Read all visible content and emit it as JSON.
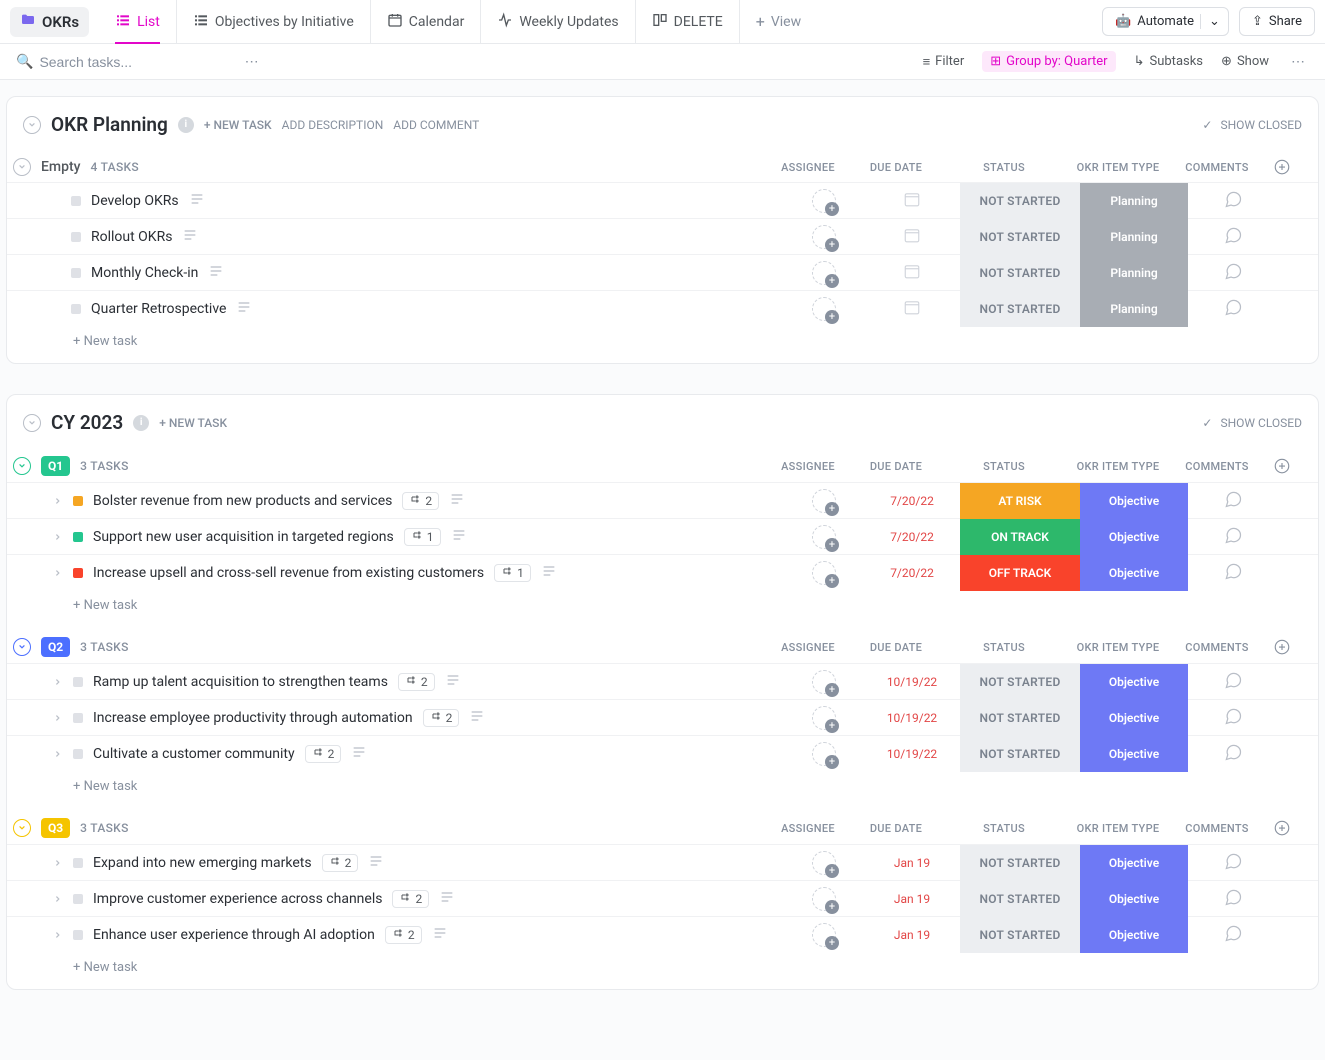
{
  "header": {
    "folder_name": "OKRs",
    "views": [
      {
        "label": "List",
        "icon": "list",
        "active": true
      },
      {
        "label": "Objectives by Initiative",
        "icon": "list2"
      },
      {
        "label": "Calendar",
        "icon": "calendar"
      },
      {
        "label": "Weekly Updates",
        "icon": "activity"
      },
      {
        "label": "DELETE",
        "icon": "board"
      }
    ],
    "add_view": "View",
    "automate": "Automate",
    "share": "Share"
  },
  "filterbar": {
    "search_placeholder": "Search tasks...",
    "filter": "Filter",
    "group_by": "Group by: Quarter",
    "subtasks": "Subtasks",
    "show": "Show"
  },
  "columns": {
    "assignee": "ASSIGNEE",
    "due": "DUE DATE",
    "status": "STATUS",
    "type": "OKR ITEM TYPE",
    "comments": "COMMENTS"
  },
  "labels": {
    "new_task_upper": "+ NEW TASK",
    "add_description": "ADD DESCRIPTION",
    "add_comment": "ADD COMMENT",
    "show_closed": "SHOW CLOSED",
    "new_task": "+ New task"
  },
  "sections": [
    {
      "title": "OKR Planning",
      "info": true,
      "actions": [
        "new_task",
        "add_description",
        "add_comment"
      ],
      "groups": [
        {
          "name": "Empty",
          "count": "4 TASKS",
          "style": "plain",
          "tasks": [
            {
              "name": "Develop OKRs",
              "desc": true,
              "status": "NOT STARTED",
              "status_class": "ns",
              "type": "Planning",
              "type_class": "planning"
            },
            {
              "name": "Rollout OKRs",
              "desc": true,
              "status": "NOT STARTED",
              "status_class": "ns",
              "type": "Planning",
              "type_class": "planning"
            },
            {
              "name": "Monthly Check-in",
              "desc": true,
              "status": "NOT STARTED",
              "status_class": "ns",
              "type": "Planning",
              "type_class": "planning"
            },
            {
              "name": "Quarter Retrospective",
              "desc": true,
              "status": "NOT STARTED",
              "status_class": "ns",
              "type": "Planning",
              "type_class": "planning"
            }
          ]
        }
      ]
    },
    {
      "title": "CY 2023",
      "info": true,
      "actions": [
        "new_task"
      ],
      "groups": [
        {
          "name": "Q1",
          "count": "3 TASKS",
          "style": "q1",
          "tasks": [
            {
              "caret": true,
              "square": "orange",
              "name": "Bolster revenue from new products and services",
              "sub": "2",
              "desc": true,
              "due": "7/20/22",
              "overdue": true,
              "status": "AT RISK",
              "status_class": "risk",
              "type": "Objective",
              "type_class": "objective"
            },
            {
              "caret": true,
              "square": "green",
              "name": "Support new user acquisition in targeted regions",
              "sub": "1",
              "desc": true,
              "due": "7/20/22",
              "overdue": true,
              "status": "ON TRACK",
              "status_class": "ontrack",
              "type": "Objective",
              "type_class": "objective"
            },
            {
              "caret": true,
              "square": "red",
              "name": "Increase upsell and cross-sell revenue from existing customers",
              "sub": "1",
              "desc": true,
              "due": "7/20/22",
              "overdue": true,
              "status": "OFF TRACK",
              "status_class": "off",
              "type": "Objective",
              "type_class": "objective"
            }
          ]
        },
        {
          "name": "Q2",
          "count": "3 TASKS",
          "style": "q2",
          "tasks": [
            {
              "caret": true,
              "name": "Ramp up talent acquisition to strengthen teams",
              "sub": "2",
              "desc": true,
              "due": "10/19/22",
              "overdue": true,
              "status": "NOT STARTED",
              "status_class": "ns",
              "type": "Objective",
              "type_class": "objective"
            },
            {
              "caret": true,
              "name": "Increase employee productivity through automation",
              "sub": "2",
              "desc": true,
              "due": "10/19/22",
              "overdue": true,
              "status": "NOT STARTED",
              "status_class": "ns",
              "type": "Objective",
              "type_class": "objective"
            },
            {
              "caret": true,
              "name": "Cultivate a customer community",
              "sub": "2",
              "desc": true,
              "due": "10/19/22",
              "overdue": true,
              "status": "NOT STARTED",
              "status_class": "ns",
              "type": "Objective",
              "type_class": "objective"
            }
          ]
        },
        {
          "name": "Q3",
          "count": "3 TASKS",
          "style": "q3",
          "tasks": [
            {
              "caret": true,
              "name": "Expand into new emerging markets",
              "sub": "2",
              "desc": true,
              "due": "Jan 19",
              "overdue": true,
              "status": "NOT STARTED",
              "status_class": "ns",
              "type": "Objective",
              "type_class": "objective"
            },
            {
              "caret": true,
              "name": "Improve customer experience across channels",
              "sub": "2",
              "desc": true,
              "due": "Jan 19",
              "overdue": true,
              "status": "NOT STARTED",
              "status_class": "ns",
              "type": "Objective",
              "type_class": "objective"
            },
            {
              "caret": true,
              "name": "Enhance user experience through AI adoption",
              "sub": "2",
              "desc": true,
              "due": "Jan 19",
              "overdue": true,
              "status": "NOT STARTED",
              "status_class": "ns",
              "type": "Objective",
              "type_class": "objective"
            }
          ]
        }
      ]
    }
  ]
}
